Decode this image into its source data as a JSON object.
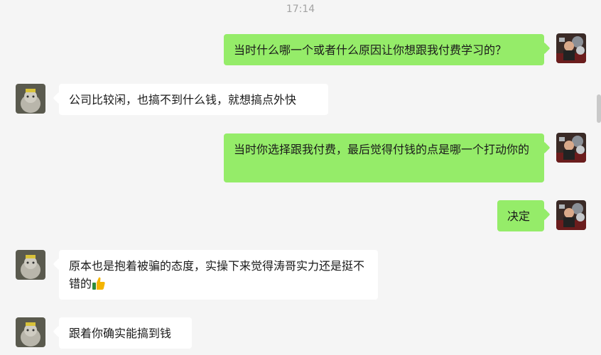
{
  "chat": {
    "timestamp": "17:14",
    "messages": [
      {
        "side": "right",
        "avatar": "user-self-avatar",
        "text": "当时什么哪一个或者什么原因让你想跟我付费学习的？"
      },
      {
        "side": "left",
        "avatar": "cat-avatar",
        "text": "公司比较闲，也搞不到什么钱，就想搞点外快"
      },
      {
        "side": "right",
        "avatar": "user-self-avatar",
        "text": "当时你选择跟我付费，最后觉得付钱的点是哪一个打动你的"
      },
      {
        "side": "right",
        "avatar": "user-self-avatar",
        "text": "决定"
      },
      {
        "side": "left",
        "avatar": "cat-avatar",
        "text": "原本也是抱着被骗的态度，实操下来觉得涛哥实力还是挺不错的",
        "emoji": "thumbs-up-icon"
      },
      {
        "side": "left",
        "avatar": "cat-avatar",
        "text": "跟着你确实能搞到钱"
      }
    ]
  },
  "colors": {
    "background": "#f5f5f5",
    "self_bubble": "#95ec69",
    "other_bubble": "#ffffff",
    "timestamp": "#a3a3a3"
  }
}
